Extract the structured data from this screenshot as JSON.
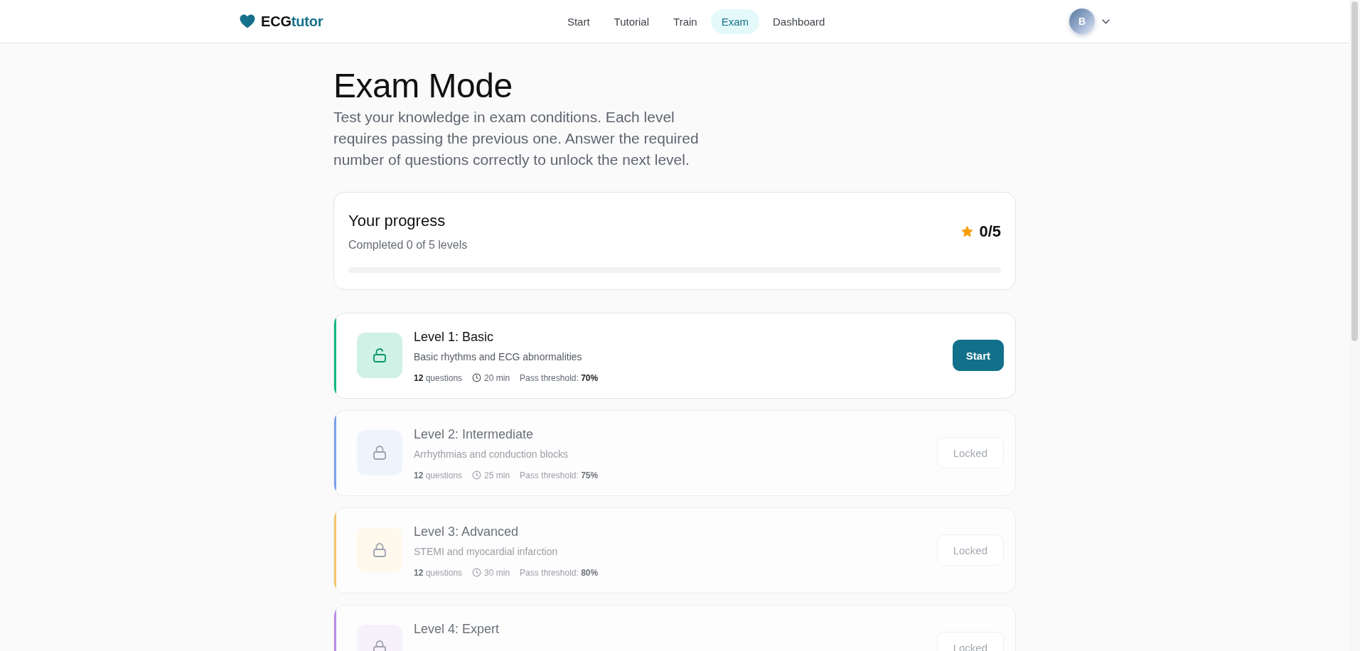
{
  "header": {
    "logo": {
      "prefix": "ECG",
      "suffix": "tutor"
    },
    "nav": [
      {
        "label": "Start",
        "selected": false
      },
      {
        "label": "Tutorial",
        "selected": false
      },
      {
        "label": "Train",
        "selected": false
      },
      {
        "label": "Exam",
        "selected": true
      },
      {
        "label": "Dashboard",
        "selected": false
      }
    ],
    "avatar": {
      "initial": "B"
    }
  },
  "page": {
    "title": "Exam Mode",
    "description": "Test your knowledge in exam conditions. Each level requires passing the previous one. Answer the required number of questions correctly to unlock the next level."
  },
  "progress": {
    "title": "Your progress",
    "subtitle": "Completed 0 of 5 levels",
    "score": "0/5",
    "level": 0
  },
  "levels": [
    {
      "title": "Level 1: Basic",
      "description": "Basic rhythms and ECG abnormalities",
      "questions": "**12** questions",
      "duration": "20 min",
      "threshold": "Pass threshold: **70%**",
      "locked": false,
      "color": "#10b981",
      "button": "Start"
    },
    {
      "title": "Level 2: Intermediate",
      "description": "Arrhythmias and conduction blocks",
      "questions": "**12** questions",
      "duration": "25 min",
      "threshold": "Pass threshold: **75%**",
      "locked": true,
      "color": "#7ba2ea",
      "button": "Locked"
    },
    {
      "title": "Level 3: Advanced",
      "description": "STEMI and myocardial infarction",
      "questions": "**12** questions",
      "duration": "30 min",
      "threshold": "Pass threshold: **80%**",
      "locked": true,
      "color": "#f4c46c",
      "button": "Locked"
    },
    {
      "title": "Level 4: Expert",
      "locked": true,
      "color": "#b98ae6",
      "button": "Locked"
    }
  ]
}
